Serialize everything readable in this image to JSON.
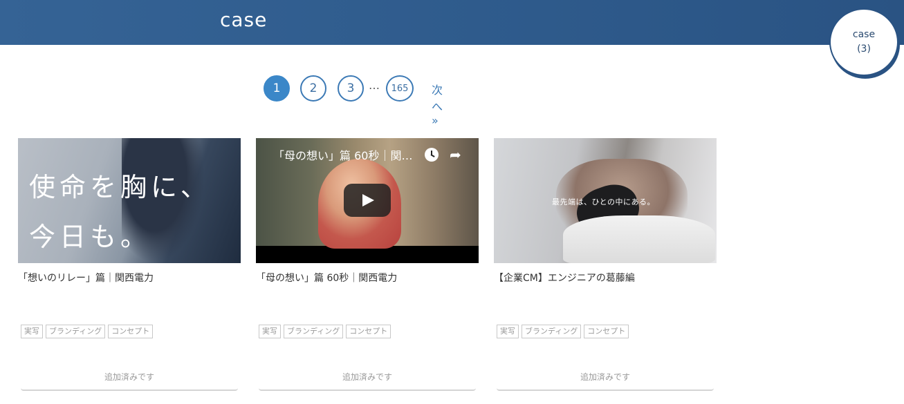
{
  "header": {
    "title": "case"
  },
  "case_badge": {
    "label": "case",
    "count": "(3)"
  },
  "pagination": {
    "pages": [
      "1",
      "2",
      "3",
      "165"
    ],
    "current": "1",
    "ellipsis": "…",
    "next_label": "次へ »"
  },
  "cards": [
    {
      "title": "「想いのリレー」篇｜関西電力",
      "thumb_text_line1": "使命を胸に、",
      "thumb_text_line2": "今日も。",
      "tags": [
        "実写",
        "ブランディング",
        "コンセプト"
      ],
      "status": "追加済みです"
    },
    {
      "title": "「母の想い」篇 60秒｜関西電力",
      "video_title": "「母の想い」篇 60秒｜関…",
      "tags": [
        "実写",
        "ブランディング",
        "コンセプト"
      ],
      "status": "追加済みです"
    },
    {
      "title": "【企業CM】エンジニアの葛藤編",
      "thumb_caption": "最先端は、ひとの中にある。",
      "tags": [
        "実写",
        "ブランディング",
        "コンセプト"
      ],
      "status": "追加済みです"
    }
  ],
  "colors": {
    "header": "#2e5a8b",
    "accent": "#3b87c8",
    "link": "#3b79b5"
  },
  "icons": {
    "clock": "clock-icon",
    "share": "share-icon",
    "play": "play-icon"
  }
}
